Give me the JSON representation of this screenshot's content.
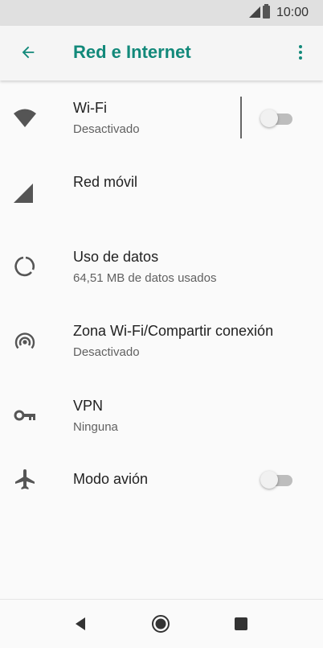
{
  "status_bar": {
    "time": "10:00"
  },
  "app_bar": {
    "title": "Red e Internet",
    "back_icon": "arrow-back-icon",
    "menu_icon": "more-vert-icon"
  },
  "items": [
    {
      "label": "Wi-Fi",
      "sub": "Desactivado",
      "icon": "wifi-icon",
      "toggle": false
    },
    {
      "label": "Red móvil",
      "icon": "cellular-signal-icon"
    },
    {
      "label": "Uso de datos",
      "sub": "64,51 MB de datos usados",
      "icon": "data-usage-icon"
    },
    {
      "label": "Zona Wi-Fi/Compartir conexión",
      "sub": "Desactivado",
      "icon": "hotspot-icon"
    },
    {
      "label": "VPN",
      "sub": "Ninguna",
      "icon": "vpn-key-icon"
    },
    {
      "label": "Modo avión",
      "icon": "airplane-icon",
      "toggle": false
    }
  ],
  "colors": {
    "accent": "#12897a",
    "toggle_off_track": "#bdbdbd",
    "toggle_off_thumb": "#f1f1f1"
  },
  "nav_bar": {
    "back": "nav-back-icon",
    "home": "nav-home-icon",
    "recents": "nav-recents-icon"
  }
}
